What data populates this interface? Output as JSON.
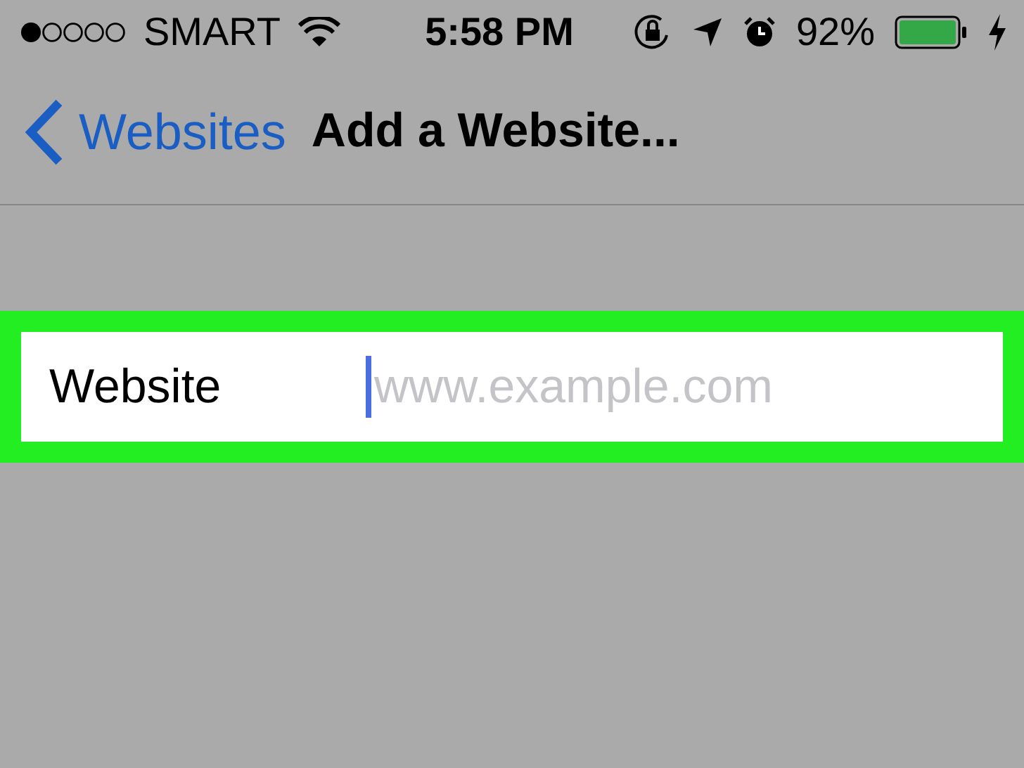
{
  "status_bar": {
    "carrier": "SMART",
    "time": "5:58 PM",
    "battery": "92%",
    "charging": true
  },
  "nav_bar": {
    "back_label": "Websites",
    "title": "Add a Website..."
  },
  "form": {
    "label": "Website",
    "placeholder": "www.example.com",
    "focused": true
  }
}
